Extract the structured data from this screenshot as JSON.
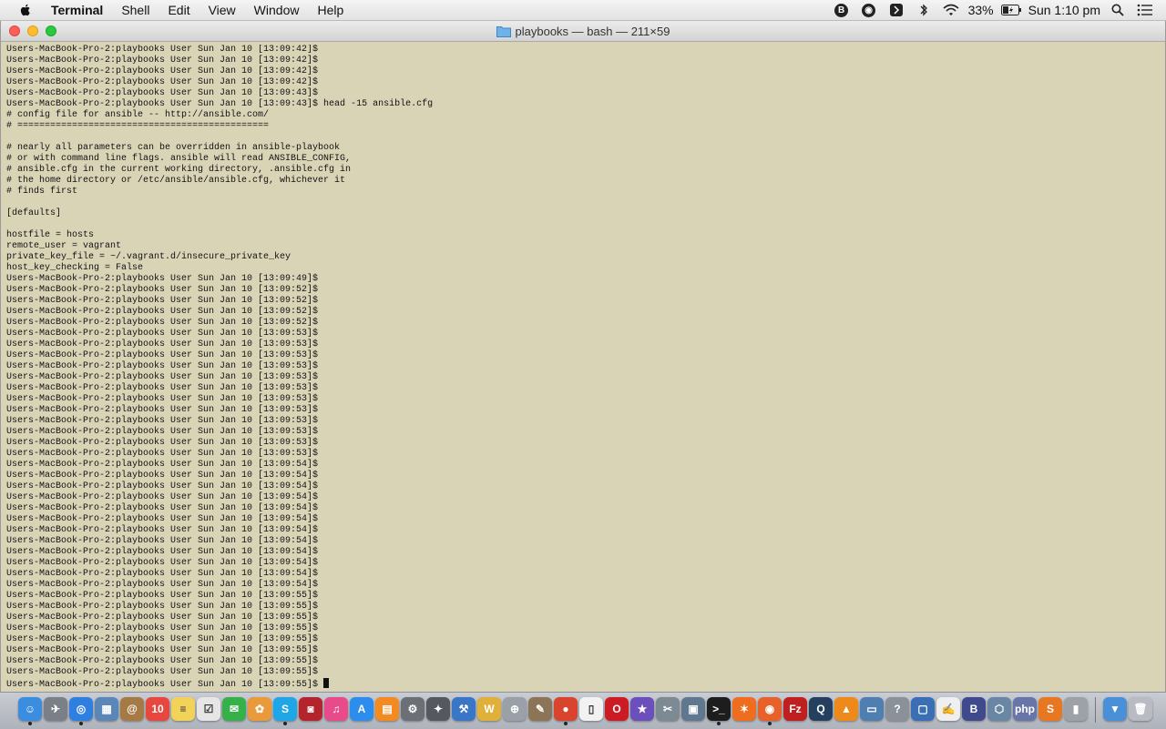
{
  "menubar": {
    "app_name": "Terminal",
    "menus": [
      "Shell",
      "Edit",
      "View",
      "Window",
      "Help"
    ],
    "status": {
      "battery": "33%",
      "clock": "Sun 1:10 pm",
      "icons": [
        "bitdefender-icon",
        "record-icon",
        "audio-icon",
        "bluetooth-icon",
        "wifi-icon",
        "battery-icon",
        "spotlight-icon",
        "notification-center-icon"
      ]
    }
  },
  "window": {
    "title": "playbooks — bash — 211×59"
  },
  "terminal": {
    "lines": [
      "Users-MacBook-Pro-2:playbooks User Sun Jan 10 [13:09:42]$",
      "Users-MacBook-Pro-2:playbooks User Sun Jan 10 [13:09:42]$",
      "Users-MacBook-Pro-2:playbooks User Sun Jan 10 [13:09:42]$",
      "Users-MacBook-Pro-2:playbooks User Sun Jan 10 [13:09:42]$",
      "Users-MacBook-Pro-2:playbooks User Sun Jan 10 [13:09:43]$",
      "Users-MacBook-Pro-2:playbooks User Sun Jan 10 [13:09:43]$ head -15 ansible.cfg",
      "# config file for ansible -- http://ansible.com/",
      "# ==============================================",
      "",
      "# nearly all parameters can be overridden in ansible-playbook",
      "# or with command line flags. ansible will read ANSIBLE_CONFIG,",
      "# ansible.cfg in the current working directory, .ansible.cfg in",
      "# the home directory or /etc/ansible/ansible.cfg, whichever it",
      "# finds first",
      "",
      "[defaults]",
      "",
      "hostfile = hosts",
      "remote_user = vagrant",
      "private_key_file = ~/.vagrant.d/insecure_private_key",
      "host_key_checking = False",
      "Users-MacBook-Pro-2:playbooks User Sun Jan 10 [13:09:49]$",
      "Users-MacBook-Pro-2:playbooks User Sun Jan 10 [13:09:52]$",
      "Users-MacBook-Pro-2:playbooks User Sun Jan 10 [13:09:52]$",
      "Users-MacBook-Pro-2:playbooks User Sun Jan 10 [13:09:52]$",
      "Users-MacBook-Pro-2:playbooks User Sun Jan 10 [13:09:52]$",
      "Users-MacBook-Pro-2:playbooks User Sun Jan 10 [13:09:53]$",
      "Users-MacBook-Pro-2:playbooks User Sun Jan 10 [13:09:53]$",
      "Users-MacBook-Pro-2:playbooks User Sun Jan 10 [13:09:53]$",
      "Users-MacBook-Pro-2:playbooks User Sun Jan 10 [13:09:53]$",
      "Users-MacBook-Pro-2:playbooks User Sun Jan 10 [13:09:53]$",
      "Users-MacBook-Pro-2:playbooks User Sun Jan 10 [13:09:53]$",
      "Users-MacBook-Pro-2:playbooks User Sun Jan 10 [13:09:53]$",
      "Users-MacBook-Pro-2:playbooks User Sun Jan 10 [13:09:53]$",
      "Users-MacBook-Pro-2:playbooks User Sun Jan 10 [13:09:53]$",
      "Users-MacBook-Pro-2:playbooks User Sun Jan 10 [13:09:53]$",
      "Users-MacBook-Pro-2:playbooks User Sun Jan 10 [13:09:53]$",
      "Users-MacBook-Pro-2:playbooks User Sun Jan 10 [13:09:53]$",
      "Users-MacBook-Pro-2:playbooks User Sun Jan 10 [13:09:54]$",
      "Users-MacBook-Pro-2:playbooks User Sun Jan 10 [13:09:54]$",
      "Users-MacBook-Pro-2:playbooks User Sun Jan 10 [13:09:54]$",
      "Users-MacBook-Pro-2:playbooks User Sun Jan 10 [13:09:54]$",
      "Users-MacBook-Pro-2:playbooks User Sun Jan 10 [13:09:54]$",
      "Users-MacBook-Pro-2:playbooks User Sun Jan 10 [13:09:54]$",
      "Users-MacBook-Pro-2:playbooks User Sun Jan 10 [13:09:54]$",
      "Users-MacBook-Pro-2:playbooks User Sun Jan 10 [13:09:54]$",
      "Users-MacBook-Pro-2:playbooks User Sun Jan 10 [13:09:54]$",
      "Users-MacBook-Pro-2:playbooks User Sun Jan 10 [13:09:54]$",
      "Users-MacBook-Pro-2:playbooks User Sun Jan 10 [13:09:54]$",
      "Users-MacBook-Pro-2:playbooks User Sun Jan 10 [13:09:54]$",
      "Users-MacBook-Pro-2:playbooks User Sun Jan 10 [13:09:55]$",
      "Users-MacBook-Pro-2:playbooks User Sun Jan 10 [13:09:55]$",
      "Users-MacBook-Pro-2:playbooks User Sun Jan 10 [13:09:55]$",
      "Users-MacBook-Pro-2:playbooks User Sun Jan 10 [13:09:55]$",
      "Users-MacBook-Pro-2:playbooks User Sun Jan 10 [13:09:55]$",
      "Users-MacBook-Pro-2:playbooks User Sun Jan 10 [13:09:55]$",
      "Users-MacBook-Pro-2:playbooks User Sun Jan 10 [13:09:55]$",
      "Users-MacBook-Pro-2:playbooks User Sun Jan 10 [13:09:55]$"
    ],
    "prompt": "Users-MacBook-Pro-2:playbooks User Sun Jan 10 [13:09:55]$ ",
    "background": "#dad4b7"
  },
  "dock": {
    "apps": [
      {
        "name": "finder-icon",
        "glyph": "☺",
        "color": "#3b8de0",
        "running": true
      },
      {
        "name": "launchpad-icon",
        "glyph": "✈",
        "color": "#7a7f88",
        "running": false
      },
      {
        "name": "safari-icon",
        "glyph": "◎",
        "color": "#2f7fe0",
        "running": true
      },
      {
        "name": "preview-icon",
        "glyph": "▦",
        "color": "#5a87b8",
        "running": false
      },
      {
        "name": "contacts-icon",
        "glyph": "@",
        "color": "#a57a45",
        "running": false
      },
      {
        "name": "calendar-icon",
        "glyph": "10",
        "color": "#e8473e",
        "running": false
      },
      {
        "name": "notes-icon",
        "glyph": "≡",
        "color": "#f1d35a",
        "running": false
      },
      {
        "name": "reminders-icon",
        "glyph": "☑",
        "color": "#e6e6e6",
        "running": false
      },
      {
        "name": "messages-icon",
        "glyph": "✉",
        "color": "#36b14a",
        "running": false
      },
      {
        "name": "photos-icon",
        "glyph": "✿",
        "color": "#e99a3a",
        "running": false
      },
      {
        "name": "skype-icon",
        "glyph": "S",
        "color": "#1ea6e6",
        "running": true
      },
      {
        "name": "photo-booth-icon",
        "glyph": "◙",
        "color": "#b4242c",
        "running": false
      },
      {
        "name": "itunes-icon",
        "glyph": "♫",
        "color": "#e84b8a",
        "running": false
      },
      {
        "name": "app-store-icon",
        "glyph": "A",
        "color": "#2c8ded",
        "running": false
      },
      {
        "name": "ibooks-icon",
        "glyph": "▤",
        "color": "#f38b22",
        "running": false
      },
      {
        "name": "system-preferences-icon",
        "glyph": "⚙",
        "color": "#6c6f76",
        "running": false
      },
      {
        "name": "automator-icon",
        "glyph": "✦",
        "color": "#55585e",
        "running": false
      },
      {
        "name": "xcode-icon",
        "glyph": "⚒",
        "color": "#3a76c6",
        "running": false
      },
      {
        "name": "cyberduck-icon",
        "glyph": "W",
        "color": "#e0b13a",
        "running": false
      },
      {
        "name": "disk-utility-icon",
        "glyph": "⊕",
        "color": "#9aa0a8",
        "running": false
      },
      {
        "name": "gimp-icon",
        "glyph": "✎",
        "color": "#8c7556",
        "running": false
      },
      {
        "name": "chrome-icon",
        "glyph": "●",
        "color": "#d9442e",
        "running": true
      },
      {
        "name": "textedit-icon",
        "glyph": "▯",
        "color": "#f2f2f2",
        "running": false
      },
      {
        "name": "opera-icon",
        "glyph": "O",
        "color": "#cc1b23",
        "running": false
      },
      {
        "name": "imovie-icon",
        "glyph": "★",
        "color": "#6b4fbb",
        "running": false
      },
      {
        "name": "dashcode-icon",
        "glyph": "✂",
        "color": "#7c8a94",
        "running": false
      },
      {
        "name": "image-capture-icon",
        "glyph": "▣",
        "color": "#5f7890",
        "running": false
      },
      {
        "name": "terminal-icon",
        "glyph": ">_",
        "color": "#1d1d1d",
        "running": true
      },
      {
        "name": "xampp-icon",
        "glyph": "✶",
        "color": "#ef6d1f",
        "running": false
      },
      {
        "name": "firefox-icon",
        "glyph": "◉",
        "color": "#e8612a",
        "running": true
      },
      {
        "name": "filezilla-icon",
        "glyph": "Fz",
        "color": "#bf1f1f",
        "running": false
      },
      {
        "name": "quicktime-icon",
        "glyph": "Q",
        "color": "#25405e",
        "running": false
      },
      {
        "name": "vlc-icon",
        "glyph": "▲",
        "color": "#ee8a1c",
        "running": false
      },
      {
        "name": "screen-sharing-icon",
        "glyph": "▭",
        "color": "#4f7fb0",
        "running": false
      },
      {
        "name": "help-icon",
        "glyph": "?",
        "color": "#8b9199",
        "running": false
      },
      {
        "name": "virtualbox-icon",
        "glyph": "▢",
        "color": "#3b6fb5",
        "running": false
      },
      {
        "name": "text-wrangler-icon",
        "glyph": "✍",
        "color": "#efefef",
        "running": false
      },
      {
        "name": "bbedit-icon",
        "glyph": "B",
        "color": "#3e4a8c",
        "running": false
      },
      {
        "name": "vagrant-box-icon",
        "glyph": "⬡",
        "color": "#6a86a5",
        "running": false
      },
      {
        "name": "php-icon",
        "glyph": "php",
        "color": "#6875a8",
        "running": false
      },
      {
        "name": "mamp-icon",
        "glyph": "S",
        "color": "#e87722",
        "running": false
      },
      {
        "name": "iphone-backup-icon",
        "glyph": "▮",
        "color": "#9da2a9",
        "running": false
      }
    ],
    "trailing": [
      {
        "name": "downloads-folder-icon",
        "glyph": "▼",
        "color": "#4a90d9",
        "running": false
      },
      {
        "name": "trash-icon",
        "glyph": "🗑",
        "color": "#b8bcc2",
        "running": false
      }
    ]
  }
}
